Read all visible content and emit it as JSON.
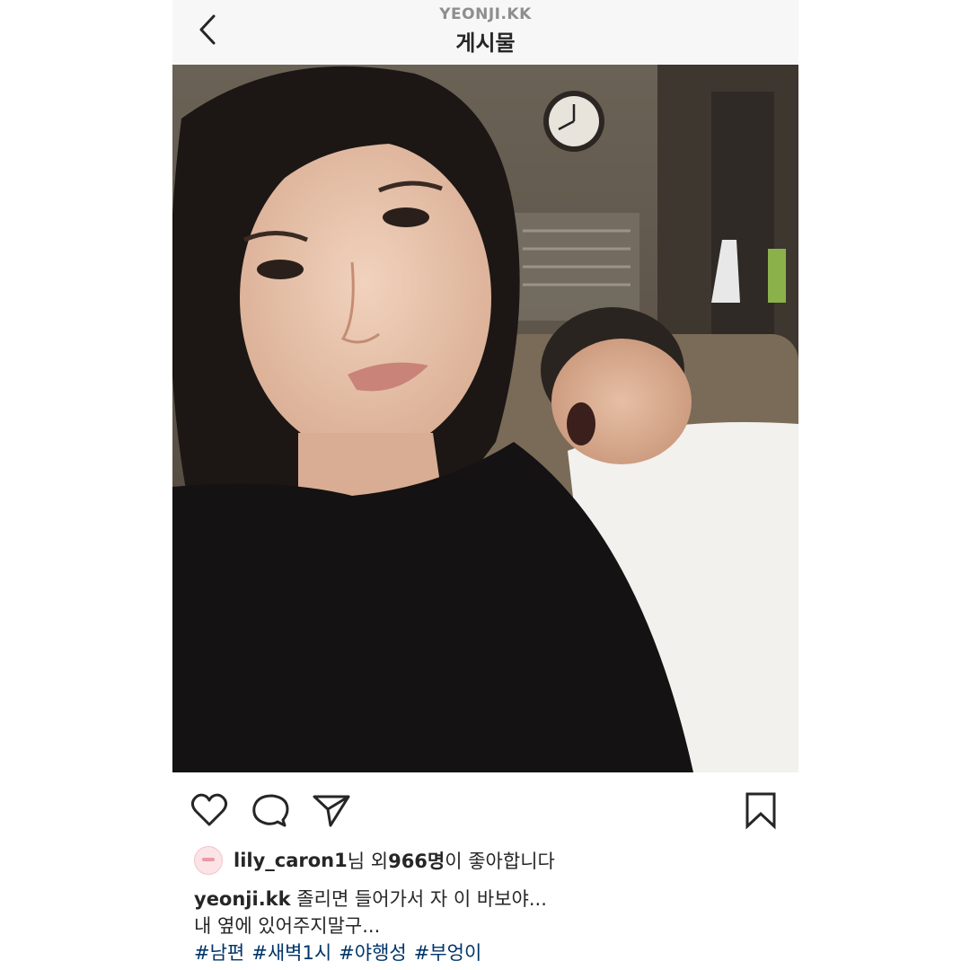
{
  "header": {
    "username": "YEONJI.KK",
    "title": "게시물"
  },
  "icons": {
    "back": "chevron-left-icon",
    "like": "heart-icon",
    "comment": "comment-bubble-icon",
    "share": "paper-plane-icon",
    "save": "bookmark-icon"
  },
  "likes": {
    "liker": "lily_caron1",
    "liker_suffix": "님 외 ",
    "count": "966명",
    "suffix": "이 좋아합니다"
  },
  "caption": {
    "author": "yeonji.kk",
    "line1": " 졸리면 들어가서 자 이 바보야...",
    "line2": "내 옆에 있어주지말구...",
    "hashtags": [
      "#남편",
      "#새벽1시",
      "#야행성",
      "#부엉이"
    ]
  },
  "colors": {
    "hashtag": "#003569",
    "text": "#262626",
    "header_bg": "#f7f7f7"
  }
}
